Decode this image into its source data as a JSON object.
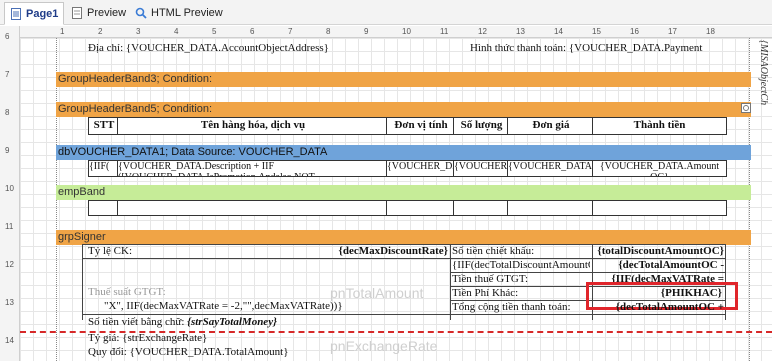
{
  "tabs": [
    {
      "label": "Page1",
      "icon": "page-icon"
    },
    {
      "label": "Preview",
      "icon": "preview-icon"
    },
    {
      "label": "HTML Preview",
      "icon": "html-preview-icon"
    }
  ],
  "ruler": {
    "top": [
      "1",
      "2",
      "3",
      "4",
      "5",
      "6",
      "7",
      "8",
      "9",
      "10",
      "11",
      "12",
      "13",
      "14",
      "15",
      "16",
      "17",
      "18"
    ],
    "left": [
      "6",
      "7",
      "8",
      "9",
      "10",
      "11",
      "12",
      "13",
      "14"
    ]
  },
  "address_row": {
    "label": "Địa chỉ: ",
    "field": "{VOUCHER_DATA.AccountObjectAddress}",
    "payment_label": "Hình thức thanh toán: ",
    "payment_field": "{VOUCHER_DATA.Payment"
  },
  "vertical_text": "{MISAObjectCh",
  "bands": {
    "group3": "GroupHeaderBand3; Condition:",
    "group5": "GroupHeaderBand5; Condition:",
    "data1": "dbVOUCHER_DATA1; Data Source: VOUCHER_DATA",
    "empty": "empBand",
    "signer": "grpSigner"
  },
  "table_headers": [
    "STT",
    "Tên hàng hóa, dịch vụ",
    "Đơn vị tính",
    "Số lượng",
    "Đơn giá",
    "Thành tiền"
  ],
  "data_row": [
    "{IIF(",
    "{VOUCHER_DATA.Description + IIF ([VOUCHER_DATA.IsPromotion.Andalso NOT",
    "{VOUCHER_DATA",
    "{VOUCHER_DATA",
    "{VOUCHER_DATA.UnitPrice",
    "{VOUCHER_DATA.Amount OC}"
  ],
  "signer": {
    "rate_label": "Tỷ lệ CK:",
    "rate_value": "{decMaxDiscountRate}",
    "vat_rate_label": "Thuế suất GTGT:",
    "vat_rate_expr": "\"X\", IIF(decMaxVATRate = -2,\"\",decMaxVATRate))}",
    "discount_label": "Số tiền chiết khấu:",
    "discount_value": "{totalDiscountAmountOC}",
    "iif_expr": "{IIF(decTotalDiscountAmountOC",
    "iif_value": "{decTotalAmountOC -",
    "vat_label": "Tiền thuế GTGT:",
    "vat_value": "{IIF(decMaxVATRate =",
    "fee_label": "Tiền Phí Khác:",
    "fee_value": "{PHIKHAC}",
    "total_label": "Tổng cộng tiền thanh toán:",
    "total_value": "{decTotalAmountOC +",
    "words_label": "Số tiền viết bằng chữ: ",
    "words_value": "{strSayTotalMoney}",
    "exchange_label": "Tỷ giá: ",
    "exchange_value": "{strExchangeRate}",
    "convert_label": "Quy đổi: ",
    "convert_value": "{VOUCHER_DATA.TotalAmount}"
  },
  "watermarks": [
    "pnTotalAmount",
    "pnExchangeRate"
  ],
  "colors": {
    "orange_band": "#f0a446",
    "blue_band": "#6fa3da",
    "green_band": "#c6ec98",
    "highlight": "#e0252b"
  }
}
